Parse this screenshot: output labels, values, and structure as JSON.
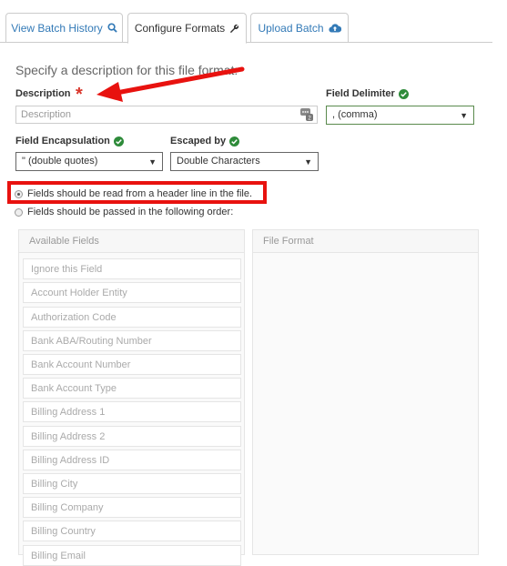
{
  "tabs": [
    {
      "label": "View Batch History",
      "icon": "search-icon"
    },
    {
      "label": "Configure Formats",
      "icon": "wrench-icon"
    },
    {
      "label": "Upload Batch",
      "icon": "cloud-upload-icon"
    }
  ],
  "heading": "Specify a description for this file format:",
  "description": {
    "label": "Description",
    "required_mark": "*",
    "placeholder": "Description"
  },
  "field_delimiter": {
    "label": "Field Delimiter",
    "value": ", (comma)"
  },
  "field_encapsulation": {
    "label": "Field Encapsulation",
    "value": "\" (double quotes)"
  },
  "escaped_by": {
    "label": "Escaped by",
    "value": "Double Characters"
  },
  "radio_options": [
    {
      "label": "Fields should be read from a header line in the file.",
      "selected": true
    },
    {
      "label": "Fields should be passed in the following order:",
      "selected": false
    }
  ],
  "available_fields": {
    "header": "Available Fields",
    "items": [
      "Ignore this Field",
      "Account Holder Entity",
      "Authorization Code",
      "Bank ABA/Routing Number",
      "Bank Account Number",
      "Bank Account Type",
      "Billing Address 1",
      "Billing Address 2",
      "Billing Address ID",
      "Billing City",
      "Billing Company",
      "Billing Country",
      "Billing Email"
    ]
  },
  "file_format": {
    "header": "File Format"
  },
  "colors": {
    "link": "#337ab7",
    "check": "#2e8b3a",
    "annotation": "#e8120f"
  }
}
